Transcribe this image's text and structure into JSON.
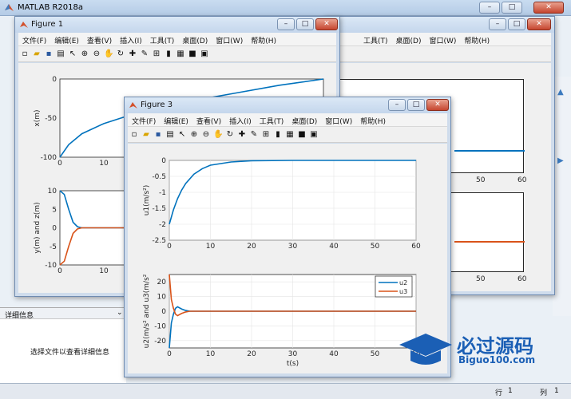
{
  "app": {
    "title": "MATLAB R2018a"
  },
  "menus": [
    "文件(F)",
    "编辑(E)",
    "查看(V)",
    "插入(I)",
    "工具(T)",
    "桌面(D)",
    "窗口(W)",
    "帮助(H)"
  ],
  "details": {
    "header": "详细信息",
    "empty": "选择文件以查看详细信息"
  },
  "status": {
    "row_label": "行",
    "row": "1",
    "col_label": "列",
    "col": "1"
  },
  "watermark": {
    "text": "必过源码",
    "sub": "Biguo100.com"
  },
  "bg_window": {
    "menus": [
      "工具(T)",
      "桌面(D)",
      "窗口(W)",
      "帮助(H)"
    ],
    "ticks_top": [
      "50",
      "60"
    ],
    "ticks_bottom": [
      "50",
      "60"
    ]
  },
  "figure1": {
    "title": "Figure 1"
  },
  "figure3": {
    "title": "Figure 3"
  },
  "chart_data": [
    {
      "type": "line",
      "figure": "Figure 1",
      "ylabel": "x(m)",
      "xlim": [
        0,
        60
      ],
      "ylim": [
        -100,
        0
      ],
      "yticks": [
        "0",
        "-50",
        "-100"
      ],
      "xticks": [
        "0",
        "10",
        "20",
        "30",
        "40",
        "50",
        "60"
      ],
      "series": [
        {
          "x": [
            0,
            2,
            5,
            10,
            15,
            20,
            30,
            40,
            50,
            60
          ],
          "values": [
            -100,
            -84,
            -70,
            -57,
            -48,
            -40,
            -28,
            -18,
            -8,
            0
          ]
        }
      ]
    },
    {
      "type": "line",
      "figure": "Figure 1",
      "ylabel": "y(m) and z(m)",
      "xlim": [
        0,
        60
      ],
      "ylim": [
        -10,
        10
      ],
      "yticks": [
        "10",
        "5",
        "0",
        "-5",
        "-10"
      ],
      "xticks": [
        "0",
        "10",
        "20",
        "30",
        "40",
        "50",
        "60"
      ],
      "series": [
        {
          "name": "vy",
          "x": [
            0,
            1,
            2,
            3,
            4,
            5,
            60
          ],
          "values": [
            10,
            9,
            5,
            1.5,
            0.3,
            0,
            0
          ]
        },
        {
          "name": "vz",
          "x": [
            0,
            1,
            2,
            3,
            4,
            5,
            60
          ],
          "values": [
            -10,
            -9,
            -5,
            -1.5,
            -0.3,
            0,
            0
          ]
        }
      ]
    },
    {
      "type": "line",
      "figure": "Figure 3",
      "ylabel": "u1(m/s²)",
      "xlim": [
        0,
        60
      ],
      "ylim": [
        -2.5,
        0
      ],
      "yticks": [
        "0",
        "-0.5",
        "-1",
        "-1.5",
        "-2",
        "-2.5"
      ],
      "xticks": [
        "0",
        "10",
        "20",
        "30",
        "40",
        "50",
        "60"
      ],
      "series": [
        {
          "x": [
            0,
            1,
            2,
            3,
            4,
            6,
            8,
            10,
            15,
            20,
            30,
            60
          ],
          "values": [
            -2,
            -1.55,
            -1.2,
            -0.93,
            -0.72,
            -0.43,
            -0.26,
            -0.15,
            -0.05,
            -0.01,
            0,
            0
          ]
        }
      ]
    },
    {
      "type": "line",
      "figure": "Figure 3",
      "ylabel": "u2(m/s² and u3(m/s²",
      "xlabel": "t(s)",
      "xlim": [
        0,
        60
      ],
      "ylim": [
        -25,
        25
      ],
      "yticks": [
        "20",
        "10",
        "0",
        "-10",
        "-20"
      ],
      "xticks": [
        "0",
        "10",
        "20",
        "30",
        "40",
        "50",
        "60"
      ],
      "series": [
        {
          "name": "u2",
          "x": [
            0,
            0.5,
            1,
            1.5,
            2,
            3,
            4,
            5,
            6,
            60
          ],
          "values": [
            -25,
            -8,
            -2,
            2,
            3,
            1.5,
            0.5,
            0,
            0,
            0
          ]
        },
        {
          "name": "u3",
          "x": [
            0,
            0.5,
            1,
            1.5,
            2,
            3,
            4,
            5,
            6,
            60
          ],
          "values": [
            25,
            8,
            2,
            -2,
            -3,
            -1.5,
            -0.5,
            0,
            0,
            0
          ]
        }
      ]
    }
  ],
  "colors": {
    "blue": "#0072bd",
    "orange": "#d95319"
  }
}
